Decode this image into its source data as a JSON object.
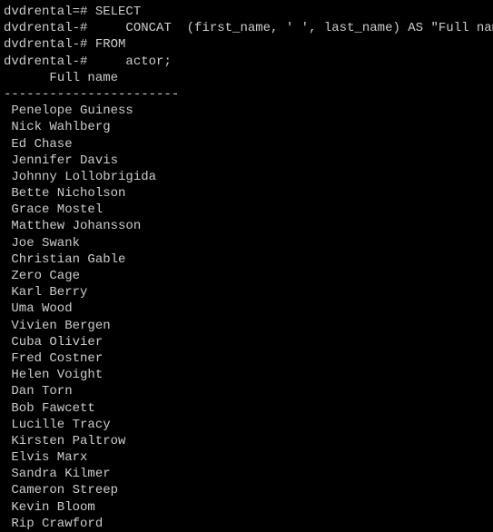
{
  "query": {
    "prompts": [
      "dvdrental=#",
      "dvdrental-#",
      "dvdrental-#",
      "dvdrental-#"
    ],
    "lines": [
      "SELECT",
      "    CONCAT  (first_name, ' ', last_name) AS \"Full name\"",
      "FROM",
      "    actor;"
    ]
  },
  "result": {
    "column_header": "Full name",
    "separator": "-----------------------",
    "rows": [
      " Penelope Guiness",
      " Nick Wahlberg",
      " Ed Chase",
      " Jennifer Davis",
      " Johnny Lollobrigida",
      " Bette Nicholson",
      " Grace Mostel",
      " Matthew Johansson",
      " Joe Swank",
      " Christian Gable",
      " Zero Cage",
      " Karl Berry",
      " Uma Wood",
      " Vivien Bergen",
      " Cuba Olivier",
      " Fred Costner",
      " Helen Voight",
      " Dan Torn",
      " Bob Fawcett",
      " Lucille Tracy",
      " Kirsten Paltrow",
      " Elvis Marx",
      " Sandra Kilmer",
      " Cameron Streep",
      " Kevin Bloom",
      " Rip Crawford"
    ]
  }
}
